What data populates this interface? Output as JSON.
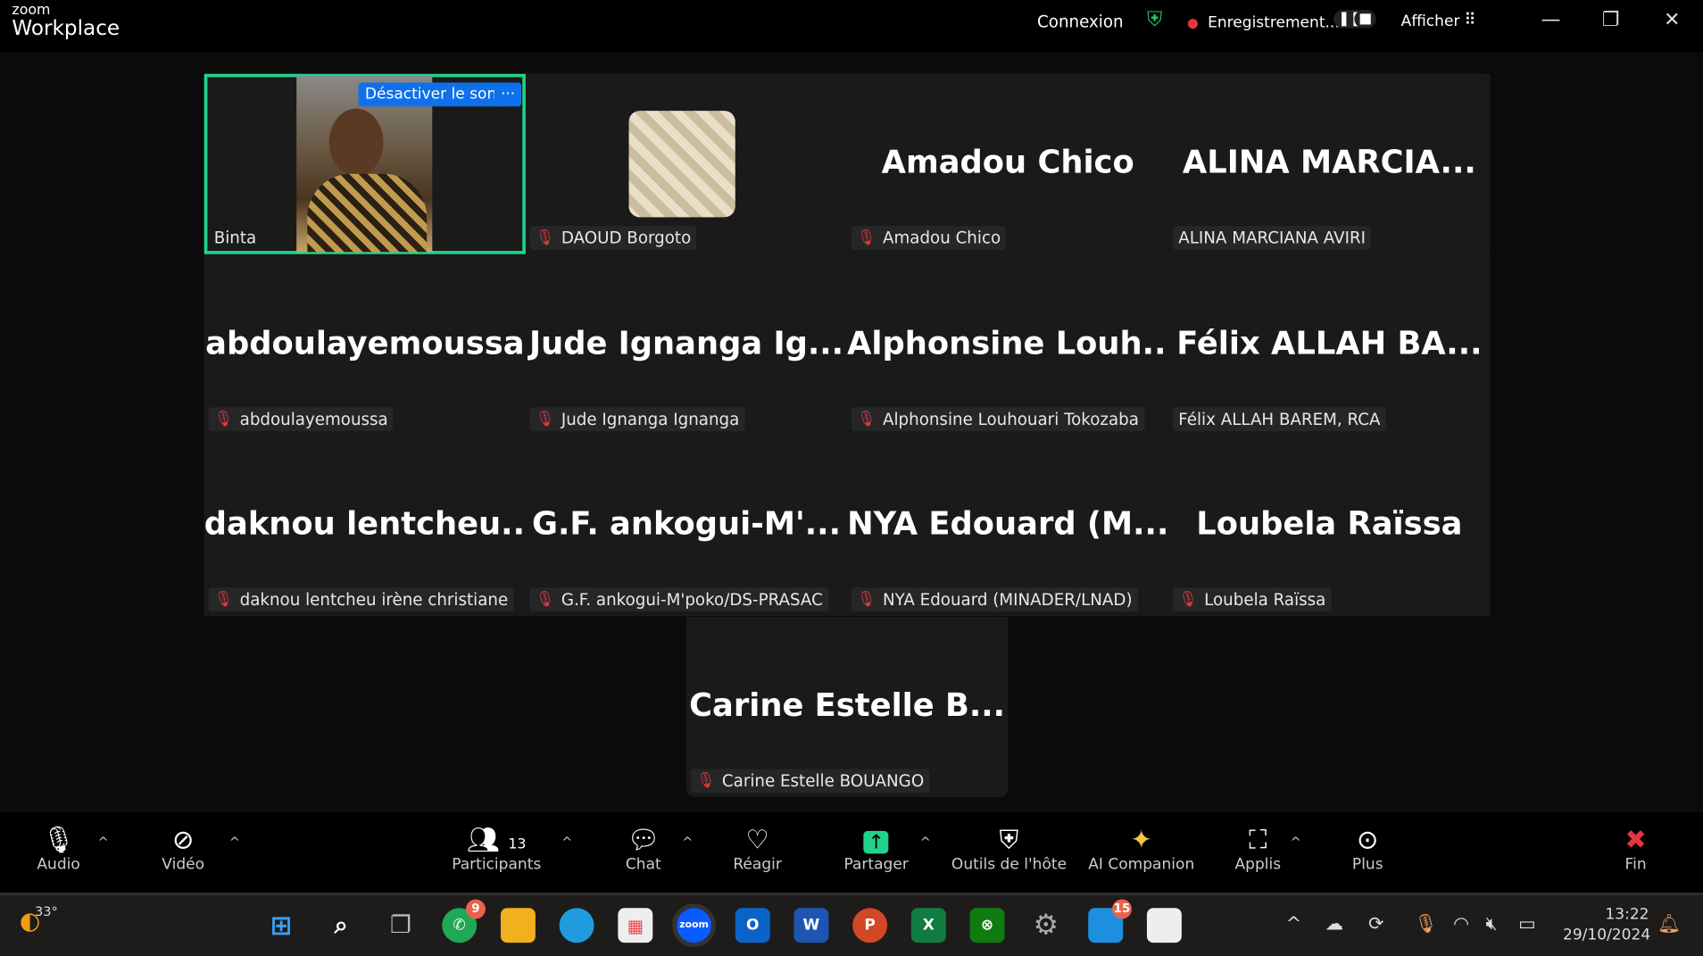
{
  "titlebar": {
    "logo_top": "zoom",
    "logo_bottom": "Workplace",
    "connexion": "Connexion",
    "recording": "Enregistrement...",
    "afficher": "Afficher"
  },
  "self_tile": {
    "name": "Binta",
    "unmute_label": "Désactiver le son",
    "more_label": "···"
  },
  "tiles": [
    {
      "big": "",
      "name": "DAOUD Borgoto",
      "muted": true
    },
    {
      "big": "Amadou Chico",
      "name": "Amadou Chico",
      "muted": true
    },
    {
      "big": "ALINA  MARCIA...",
      "name": "ALINA MARCIANA AVIRI",
      "muted": false
    },
    {
      "big": "abdoulayemoussa",
      "name": "abdoulayemoussa",
      "muted": true
    },
    {
      "big": "Jude  Ignanga  Ig...",
      "name": "Jude Ignanga Ignanga",
      "muted": true
    },
    {
      "big": "Alphonsine  Louh...",
      "name": "Alphonsine Louhouari Tokozaba",
      "muted": true
    },
    {
      "big": "Félix  ALLAH  BA...",
      "name": "Félix ALLAH BAREM, RCA",
      "muted": false
    },
    {
      "big": "daknou  lentcheu...",
      "name": "daknou lentcheu irène christiane",
      "muted": true
    },
    {
      "big": "G.F.  ankogui-M'...",
      "name": "G.F. ankogui-M'poko/DS-PRASAC",
      "muted": true
    },
    {
      "big": "NYA  Edouard  (M...",
      "name": "NYA Edouard (MINADER/LNAD)",
      "muted": true
    },
    {
      "big": "Loubela  Raïssa",
      "name": "Loubela Raïssa",
      "muted": true
    },
    {
      "big": "Carine  Estelle  B...",
      "name": "Carine Estelle BOUANGO",
      "muted": true
    }
  ],
  "toolbar": {
    "audio": "Audio",
    "video": "Vidéo",
    "participants": "Participants",
    "participants_count": "13",
    "chat": "Chat",
    "react": "Réagir",
    "share": "Partager",
    "host_tools": "Outils de l'hôte",
    "ai": "AI Companion",
    "apps": "Applis",
    "more": "Plus",
    "end": "Fin"
  },
  "taskbar": {
    "weather": "33°",
    "whatsapp_badge": "9",
    "outlook_badge": "15",
    "time": "13:22",
    "date": "29/10/2024",
    "apps": {
      "zoom": "zoom",
      "outlook": "O",
      "word": "W",
      "powerpoint": "P",
      "excel": "X"
    }
  },
  "colors": {
    "accent_green": "#1fd38a",
    "blue": "#0e71eb",
    "red": "#e0383e",
    "share": "#1fd38a"
  }
}
